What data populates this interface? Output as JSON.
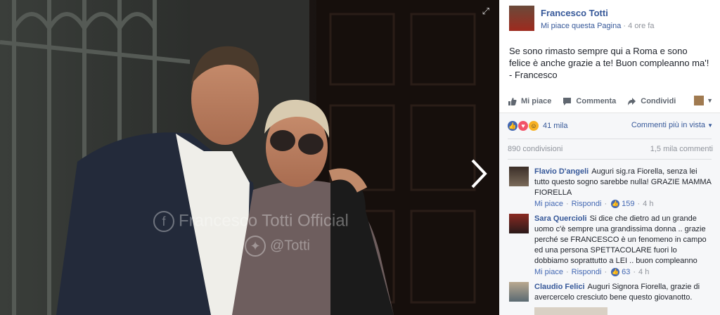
{
  "page": {
    "name": "Francesco Totti",
    "like_page": "Mi piace questa Pagina",
    "time": "4 ore fa"
  },
  "post_text": "Se sono rimasto sempre qui a Roma e sono felice è anche grazie a te! Buon compleanno ma'! - Francesco",
  "actions": {
    "like": "Mi piace",
    "comment": "Commenta",
    "share": "Condividi"
  },
  "reactions": {
    "count": "41 mila",
    "sort": "Commenti più in vista"
  },
  "stats": {
    "shares": "890 condivisioni",
    "comments": "1,5 mila commenti"
  },
  "watermark": {
    "line1": "Francesco Totti Official",
    "line2": "@Totti"
  },
  "comments": [
    {
      "author": "Flavio D'angeli",
      "text": "Auguri sig.ra Fiorella, senza lei tutto questo sogno sarebbe nulla! GRAZIE MAMMA FIORELLA",
      "like": "Mi piace",
      "reply": "Rispondi",
      "likes": "159",
      "time": "4 h"
    },
    {
      "author": "Sara Quercioli",
      "text": "Si dice che dietro ad un grande uomo c'è sempre una grandissima donna .. grazie perché se FRANCESCO è un fenomeno in campo ed una persona SPETTACOLARE fuori lo dobbiamo soprattutto a LEI .. buon compleanno",
      "like": "Mi piace",
      "reply": "Rispondi",
      "likes": "63",
      "time": "4 h"
    },
    {
      "author": "Claudio Felici",
      "text": "Auguri Signora Fiorella, grazie di avercercelo cresciuto bene questo giovanotto."
    }
  ],
  "colors": {
    "link": "#365899",
    "like_blue": "#4267b2",
    "panel_bg": "#ffffff",
    "feedback_bg": "#f6f7f9"
  }
}
